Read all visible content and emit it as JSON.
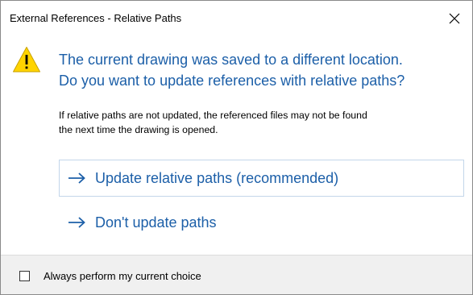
{
  "window": {
    "title": "External References - Relative Paths",
    "close_icon": "close-x-icon"
  },
  "main": {
    "icon": "warning-triangle-icon",
    "heading_line1": "The current drawing was saved to a different location.",
    "heading_line2": "Do you want to update references with relative paths?",
    "note_line1": "If relative paths are not updated, the referenced files may not be found",
    "note_line2": "the next time the drawing is opened."
  },
  "commands": [
    {
      "label": "Update relative paths (recommended)",
      "icon": "right-arrow-icon"
    },
    {
      "label": "Don't update paths",
      "icon": "right-arrow-icon"
    }
  ],
  "footer": {
    "checkbox_label": "Always perform my current choice",
    "checked": false
  },
  "colors": {
    "accent_text": "#1c5fa8",
    "warning_fill": "#ffd400",
    "footer_bg": "#f0f0f0"
  }
}
